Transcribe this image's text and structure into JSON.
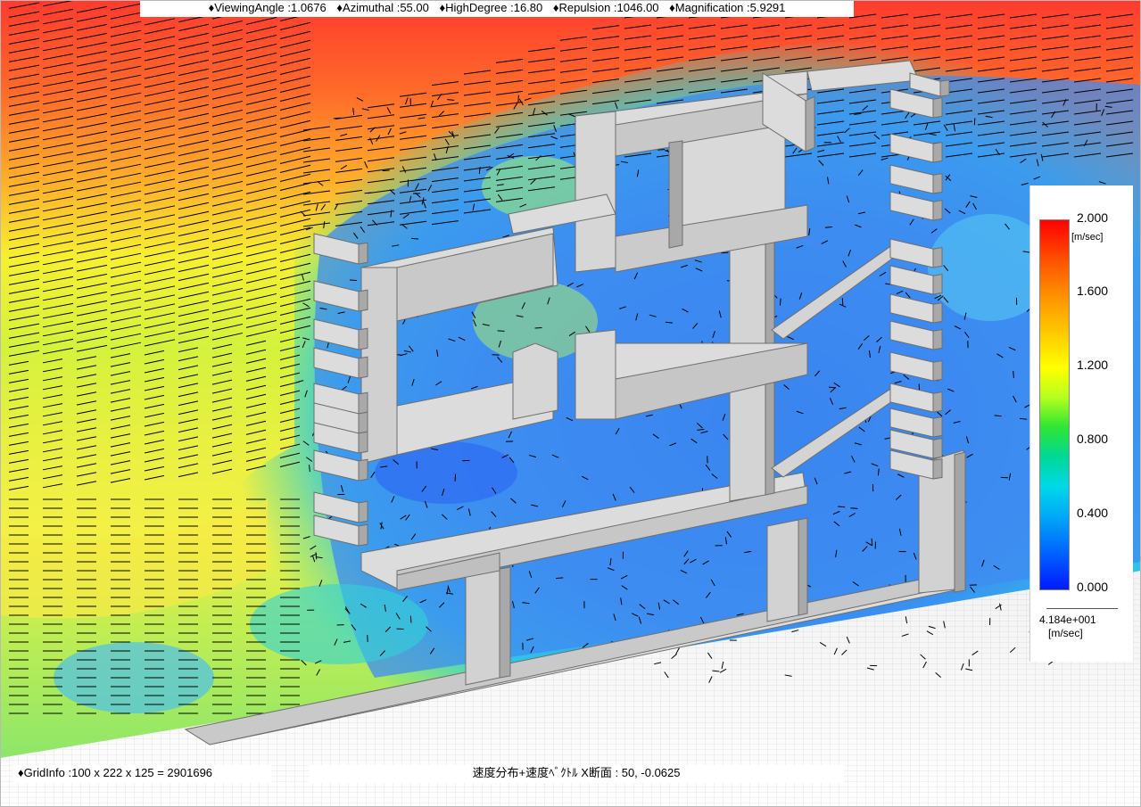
{
  "toolbar": {
    "params": [
      "♦ViewingAngle :1.0676",
      "♦Azimuthal :55.00",
      "♦HighDegree :16.80",
      "♦Repulsion :1046.00",
      "♦Magnification :5.9291"
    ]
  },
  "legend": {
    "max_label": "2.000",
    "unit": "[m/sec]",
    "tick_labels": [
      "1.600",
      "1.200",
      "0.800",
      "0.400",
      "0.000"
    ],
    "reference_value": "4.184e+001",
    "reference_unit": "[m/sec]",
    "range_min": 0.0,
    "range_max": 2.0,
    "colors": [
      "#ff0000",
      "#ff9900",
      "#ffff00",
      "#2fe634",
      "#00d9e8",
      "#0064ff",
      "#0019ff"
    ]
  },
  "status": {
    "grid_info": "♦GridInfo :100 x 222 x 125 = 2901696",
    "section_info": "速度分布+速度ﾍﾞｸﾄﾙ X断面 : 50, -0.0625"
  },
  "scene": {
    "structure_color": "#dcdcdc",
    "structure_edge": "#6e6e6e",
    "ground_color": "#eeeeee"
  }
}
